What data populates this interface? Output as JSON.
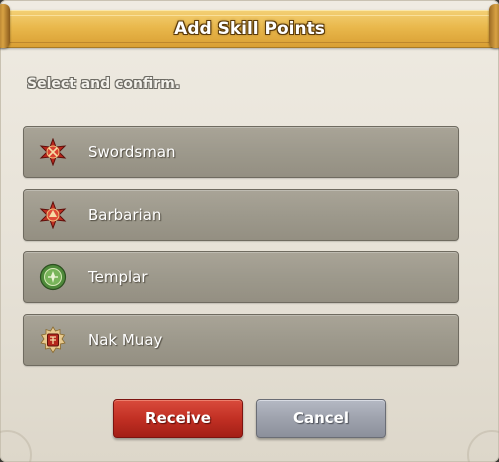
{
  "dialog": {
    "title": "Add Skill Points",
    "instruction": "Select and confirm."
  },
  "options": [
    {
      "label": "Swordsman",
      "icon": "swordsman-class-icon"
    },
    {
      "label": "Barbarian",
      "icon": "barbarian-class-icon"
    },
    {
      "label": "Templar",
      "icon": "templar-class-icon"
    },
    {
      "label": "Nak Muay",
      "icon": "nak-muay-class-icon"
    }
  ],
  "buttons": {
    "receive_label": "Receive",
    "cancel_label": "Cancel"
  },
  "colors": {
    "title_bar": "#e9b84c",
    "option_bg": "#9d998c",
    "receive_button": "#c23024",
    "cancel_button": "#9ea2ad"
  }
}
